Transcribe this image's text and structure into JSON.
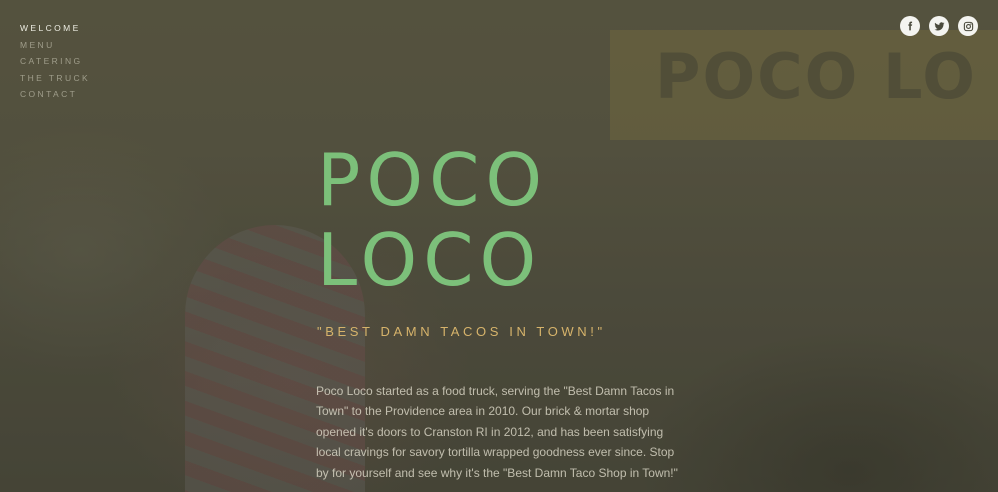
{
  "nav": {
    "items": [
      {
        "label": "WELCOME",
        "active": true
      },
      {
        "label": "MENU",
        "active": false
      },
      {
        "label": "CATERING",
        "active": false
      },
      {
        "label": "THE TRUCK",
        "active": false
      },
      {
        "label": "CONTACT",
        "active": false
      }
    ]
  },
  "social": {
    "icons": [
      "facebook-icon",
      "twitter-icon",
      "instagram-icon"
    ]
  },
  "hero": {
    "background_sign_text": "POCO LO",
    "title_line1": "POCO",
    "title_line2": "LOCO",
    "tagline": "\"BEST DAMN TACOS IN TOWN!\"",
    "description": "Poco Loco started as a food truck, serving the \"Best Damn Tacos in Town\" to the Providence area in 2010. Our brick & mortar shop opened it's doors to Cranston RI in 2012, and has been satisfying local cravings for savory tortilla wrapped goodness ever since. Stop by for yourself and see why it's the \"Best Damn Taco Shop in Town!\""
  },
  "colors": {
    "title": "#7cc07a",
    "tagline": "#d6b36b",
    "body_text": "#e1decd",
    "nav_active": "#f5f5eb",
    "social_bg": "#f4f4f0",
    "social_icon": "#4a4a3c"
  }
}
